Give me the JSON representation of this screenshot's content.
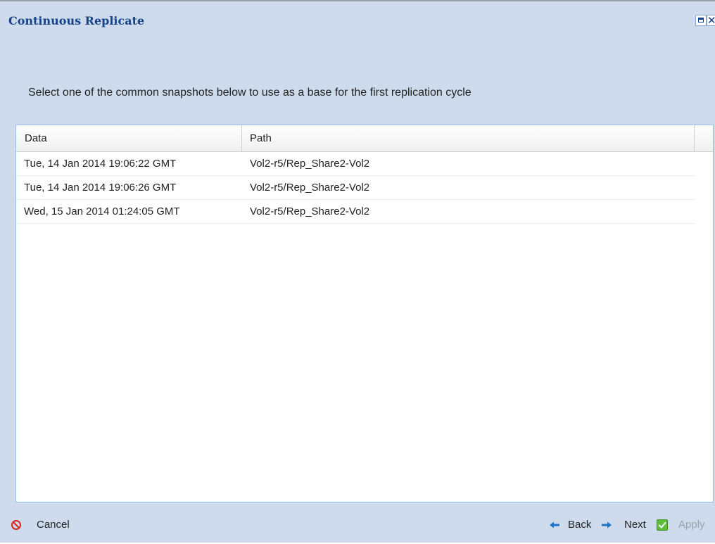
{
  "window": {
    "title": "Continuous Replicate",
    "tools": {
      "maximize_icon": "maximize-icon",
      "close_icon": "close-icon",
      "close_glyph": "✕"
    }
  },
  "instruction": "Select one of the common snapshots below to use as a base for the first replication cycle",
  "table": {
    "columns": [
      "Data",
      "Path"
    ],
    "rows": [
      {
        "data": "Tue, 14 Jan 2014 19:06:22 GMT",
        "path": "Vol2-r5/Rep_Share2-Vol2"
      },
      {
        "data": "Tue, 14 Jan 2014 19:06:26 GMT",
        "path": "Vol2-r5/Rep_Share2-Vol2"
      },
      {
        "data": "Wed, 15 Jan 2014 01:24:05 GMT",
        "path": "Vol2-r5/Rep_Share2-Vol2"
      }
    ]
  },
  "buttons": {
    "cancel": {
      "label": "Cancel",
      "icon": "cancel-icon"
    },
    "back": {
      "label": "Back",
      "icon": "arrow-left-icon"
    },
    "next": {
      "label": "Next",
      "icon": "arrow-right-icon"
    },
    "apply": {
      "label": "Apply",
      "icon": "check-icon",
      "disabled": true
    }
  },
  "colors": {
    "window_bg": "#cddbec",
    "title": "#15428b",
    "arrow": "#1a73c8",
    "cancel_icon": "#d9261c",
    "apply_icon": "#5fbf3a",
    "disabled_text": "#9aa3ad"
  }
}
